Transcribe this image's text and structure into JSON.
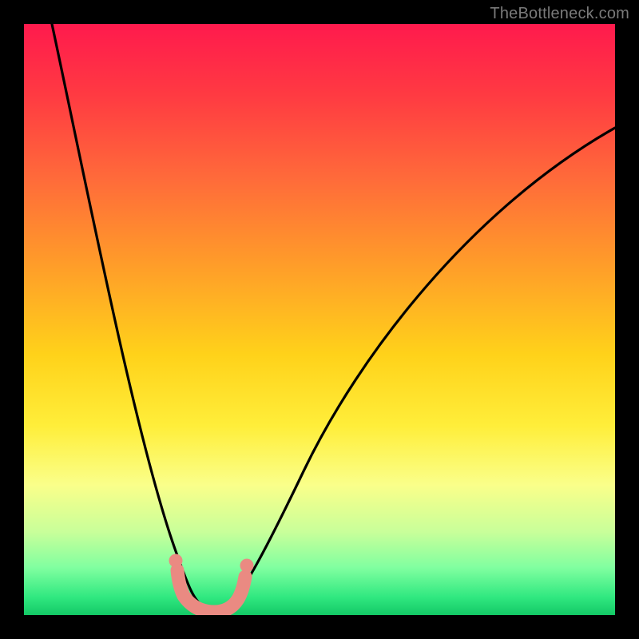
{
  "attribution": "TheBottleneck.com",
  "chart_data": {
    "type": "line",
    "title": "",
    "xlabel": "",
    "ylabel": "",
    "xlim": [
      0,
      100
    ],
    "ylim": [
      0,
      100
    ],
    "axes_visible": false,
    "grid": false,
    "background_gradient": {
      "orientation": "vertical",
      "stops": [
        {
          "pos": 0.0,
          "color": "#ff1a4d"
        },
        {
          "pos": 0.4,
          "color": "#ff9a2a"
        },
        {
          "pos": 0.68,
          "color": "#ffee3a"
        },
        {
          "pos": 0.9,
          "color": "#80ffa0"
        },
        {
          "pos": 1.0,
          "color": "#14c966"
        }
      ]
    },
    "series": [
      {
        "name": "bottleneck-curve",
        "stroke": "#000000",
        "x": [
          4,
          6,
          8,
          10,
          12,
          14,
          16,
          18,
          20,
          22,
          24,
          26,
          27,
          28,
          30,
          32,
          34,
          36,
          40,
          46,
          54,
          62,
          70,
          80,
          90,
          100
        ],
        "values": [
          100,
          92,
          84,
          76,
          68,
          60,
          52,
          44,
          36,
          28,
          20,
          12,
          7,
          3,
          1,
          1,
          3,
          7,
          14,
          24,
          36,
          47,
          56,
          64,
          70,
          74
        ]
      }
    ],
    "annotations": [
      {
        "name": "trough-marker",
        "shape": "u-marker",
        "color": "#e98b82",
        "x_range": [
          26,
          36
        ],
        "y": 2,
        "stroke_width_px": 16
      }
    ]
  }
}
